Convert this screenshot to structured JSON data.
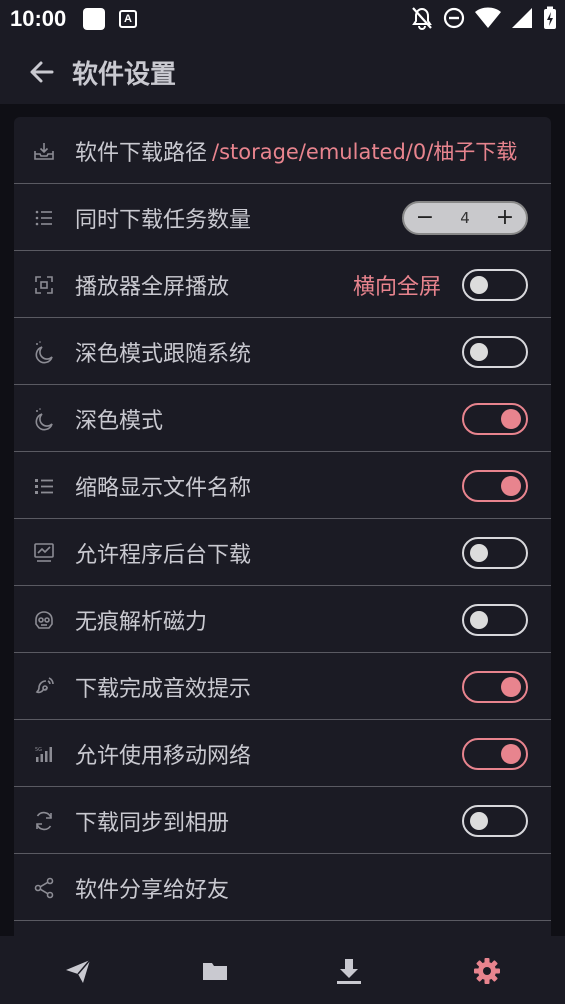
{
  "status": {
    "time": "10:00",
    "a_badge": "A"
  },
  "header": {
    "title": "软件设置"
  },
  "settings": {
    "download_path": {
      "label": "软件下载路径",
      "value": "/storage/emulated/0/柚子下载",
      "icon": "download-tray-icon"
    },
    "concurrent": {
      "label": "同时下载任务数量",
      "value": "4",
      "minus": "−",
      "plus": "+",
      "icon": "list-icon"
    },
    "fullscreen": {
      "label": "播放器全屏播放",
      "value": "横向全屏",
      "on": false,
      "icon": "fullscreen-icon"
    },
    "dark_follow": {
      "label": "深色模式跟随系统",
      "on": false,
      "icon": "moon-icon"
    },
    "dark": {
      "label": "深色模式",
      "on": true,
      "icon": "moon-icon"
    },
    "abbrev": {
      "label": "缩略显示文件名称",
      "on": true,
      "icon": "list-icon"
    },
    "background": {
      "label": "允许程序后台下载",
      "on": false,
      "icon": "monitor-chart-icon"
    },
    "incognito": {
      "label": "无痕解析磁力",
      "on": false,
      "icon": "incognito-icon"
    },
    "sound": {
      "label": "下载完成音效提示",
      "on": true,
      "icon": "sound-icon"
    },
    "mobile": {
      "label": "允许使用移动网络",
      "on": true,
      "icon": "signal-icon"
    },
    "sync_album": {
      "label": "下载同步到相册",
      "on": false,
      "icon": "sync-icon"
    },
    "share": {
      "label": "软件分享给好友",
      "icon": "share-icon"
    }
  },
  "nav": {
    "items": [
      "send-icon",
      "folder-icon",
      "download-icon",
      "settings-gear-icon"
    ],
    "active_color": "#e8848e",
    "inactive_color": "#c9c9d0"
  },
  "colors": {
    "accent": "#e8848e",
    "background": "#1b1b24",
    "divider": "#5a5a62"
  }
}
